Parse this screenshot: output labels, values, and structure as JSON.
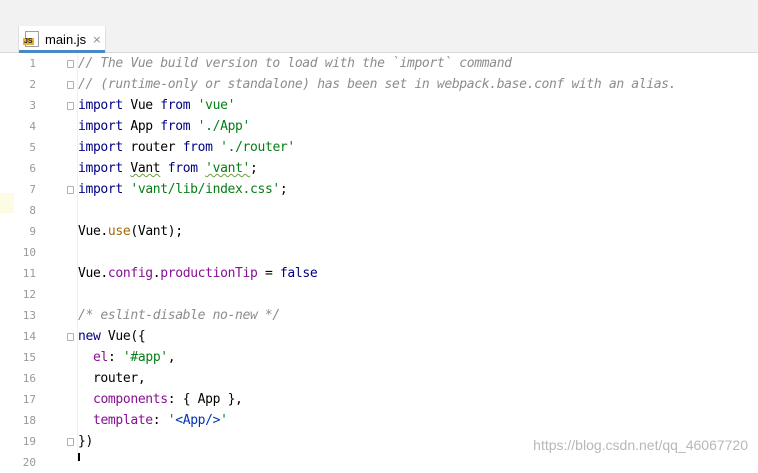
{
  "tab": {
    "icon": "js-file-icon",
    "icon_badge": "JS",
    "label": "main.js",
    "close": "×"
  },
  "lines": [
    {
      "num": "1",
      "fold": true,
      "tokens": [
        {
          "t": "// The Vue build version to load with the `import` command",
          "c": "cm"
        }
      ]
    },
    {
      "num": "2",
      "fold": true,
      "tokens": [
        {
          "t": "// (runtime-only or standalone) has been set in webpack.base.conf with an alias.",
          "c": "cm"
        }
      ]
    },
    {
      "num": "3",
      "fold": true,
      "tokens": [
        {
          "t": "import",
          "c": "kw"
        },
        {
          "t": " Vue ",
          "c": "id"
        },
        {
          "t": "from",
          "c": "kw"
        },
        {
          "t": " ",
          "c": "id"
        },
        {
          "t": "'vue'",
          "c": "str"
        }
      ]
    },
    {
      "num": "4",
      "fold": false,
      "tokens": [
        {
          "t": "import",
          "c": "kw"
        },
        {
          "t": " App ",
          "c": "id"
        },
        {
          "t": "from",
          "c": "kw"
        },
        {
          "t": " ",
          "c": "id"
        },
        {
          "t": "'./App'",
          "c": "str"
        }
      ]
    },
    {
      "num": "5",
      "fold": false,
      "tokens": [
        {
          "t": "import",
          "c": "kw"
        },
        {
          "t": " router ",
          "c": "id"
        },
        {
          "t": "from",
          "c": "kw"
        },
        {
          "t": " ",
          "c": "id"
        },
        {
          "t": "'./router'",
          "c": "str"
        }
      ]
    },
    {
      "num": "6",
      "fold": false,
      "tokens": [
        {
          "t": "import",
          "c": "kw"
        },
        {
          "t": " ",
          "c": "id"
        },
        {
          "t": "Vant",
          "c": "id",
          "sq": true
        },
        {
          "t": " ",
          "c": "id"
        },
        {
          "t": "from",
          "c": "kw"
        },
        {
          "t": " ",
          "c": "id"
        },
        {
          "t": "'vant'",
          "c": "str",
          "sq": true
        },
        {
          "t": ";",
          "c": "id"
        }
      ]
    },
    {
      "num": "7",
      "fold": true,
      "tokens": [
        {
          "t": "import",
          "c": "kw"
        },
        {
          "t": " ",
          "c": "id"
        },
        {
          "t": "'vant/lib/index.css'",
          "c": "str"
        },
        {
          "t": ";",
          "c": "id"
        }
      ]
    },
    {
      "num": "8",
      "fold": false,
      "tokens": []
    },
    {
      "num": "9",
      "fold": false,
      "tokens": [
        {
          "t": "Vue.",
          "c": "id"
        },
        {
          "t": "use",
          "c": "fn"
        },
        {
          "t": "(Vant);",
          "c": "id"
        }
      ]
    },
    {
      "num": "10",
      "fold": false,
      "tokens": []
    },
    {
      "num": "11",
      "fold": false,
      "tokens": [
        {
          "t": "Vue.",
          "c": "id"
        },
        {
          "t": "config",
          "c": "mem"
        },
        {
          "t": ".",
          "c": "id"
        },
        {
          "t": "productionTip",
          "c": "mem"
        },
        {
          "t": " = ",
          "c": "id"
        },
        {
          "t": "false",
          "c": "kw"
        }
      ]
    },
    {
      "num": "12",
      "fold": false,
      "tokens": []
    },
    {
      "num": "13",
      "fold": false,
      "tokens": [
        {
          "t": "/* eslint-disable no-new */",
          "c": "cm"
        }
      ]
    },
    {
      "num": "14",
      "fold": true,
      "tokens": [
        {
          "t": "new",
          "c": "kw"
        },
        {
          "t": " Vue({",
          "c": "id"
        }
      ]
    },
    {
      "num": "15",
      "fold": false,
      "tokens": [
        {
          "t": "  ",
          "c": "id"
        },
        {
          "t": "el",
          "c": "mem"
        },
        {
          "t": ": ",
          "c": "id"
        },
        {
          "t": "'#app'",
          "c": "str"
        },
        {
          "t": ",",
          "c": "id"
        }
      ]
    },
    {
      "num": "16",
      "fold": false,
      "tokens": [
        {
          "t": "  router,",
          "c": "id"
        }
      ]
    },
    {
      "num": "17",
      "fold": false,
      "tokens": [
        {
          "t": "  ",
          "c": "id"
        },
        {
          "t": "components",
          "c": "mem"
        },
        {
          "t": ": { App },",
          "c": "id"
        }
      ]
    },
    {
      "num": "18",
      "fold": false,
      "tokens": [
        {
          "t": "  ",
          "c": "id"
        },
        {
          "t": "template",
          "c": "mem"
        },
        {
          "t": ": ",
          "c": "id"
        },
        {
          "t": "'",
          "c": "str"
        },
        {
          "t": "<App/>",
          "c": "tag"
        },
        {
          "t": "'",
          "c": "str"
        }
      ]
    },
    {
      "num": "19",
      "fold": true,
      "tokens": [
        {
          "t": "})",
          "c": "id"
        }
      ]
    },
    {
      "num": "20",
      "fold": false,
      "tokens": []
    }
  ],
  "watermark": "https://blog.csdn.net/qq_46067720",
  "colors": {
    "keyword": "#000080",
    "string": "#067d17",
    "comment": "#8c8c8c",
    "member": "#871094",
    "function": "#9e6a03",
    "tab_accent": "#4a88c7"
  }
}
